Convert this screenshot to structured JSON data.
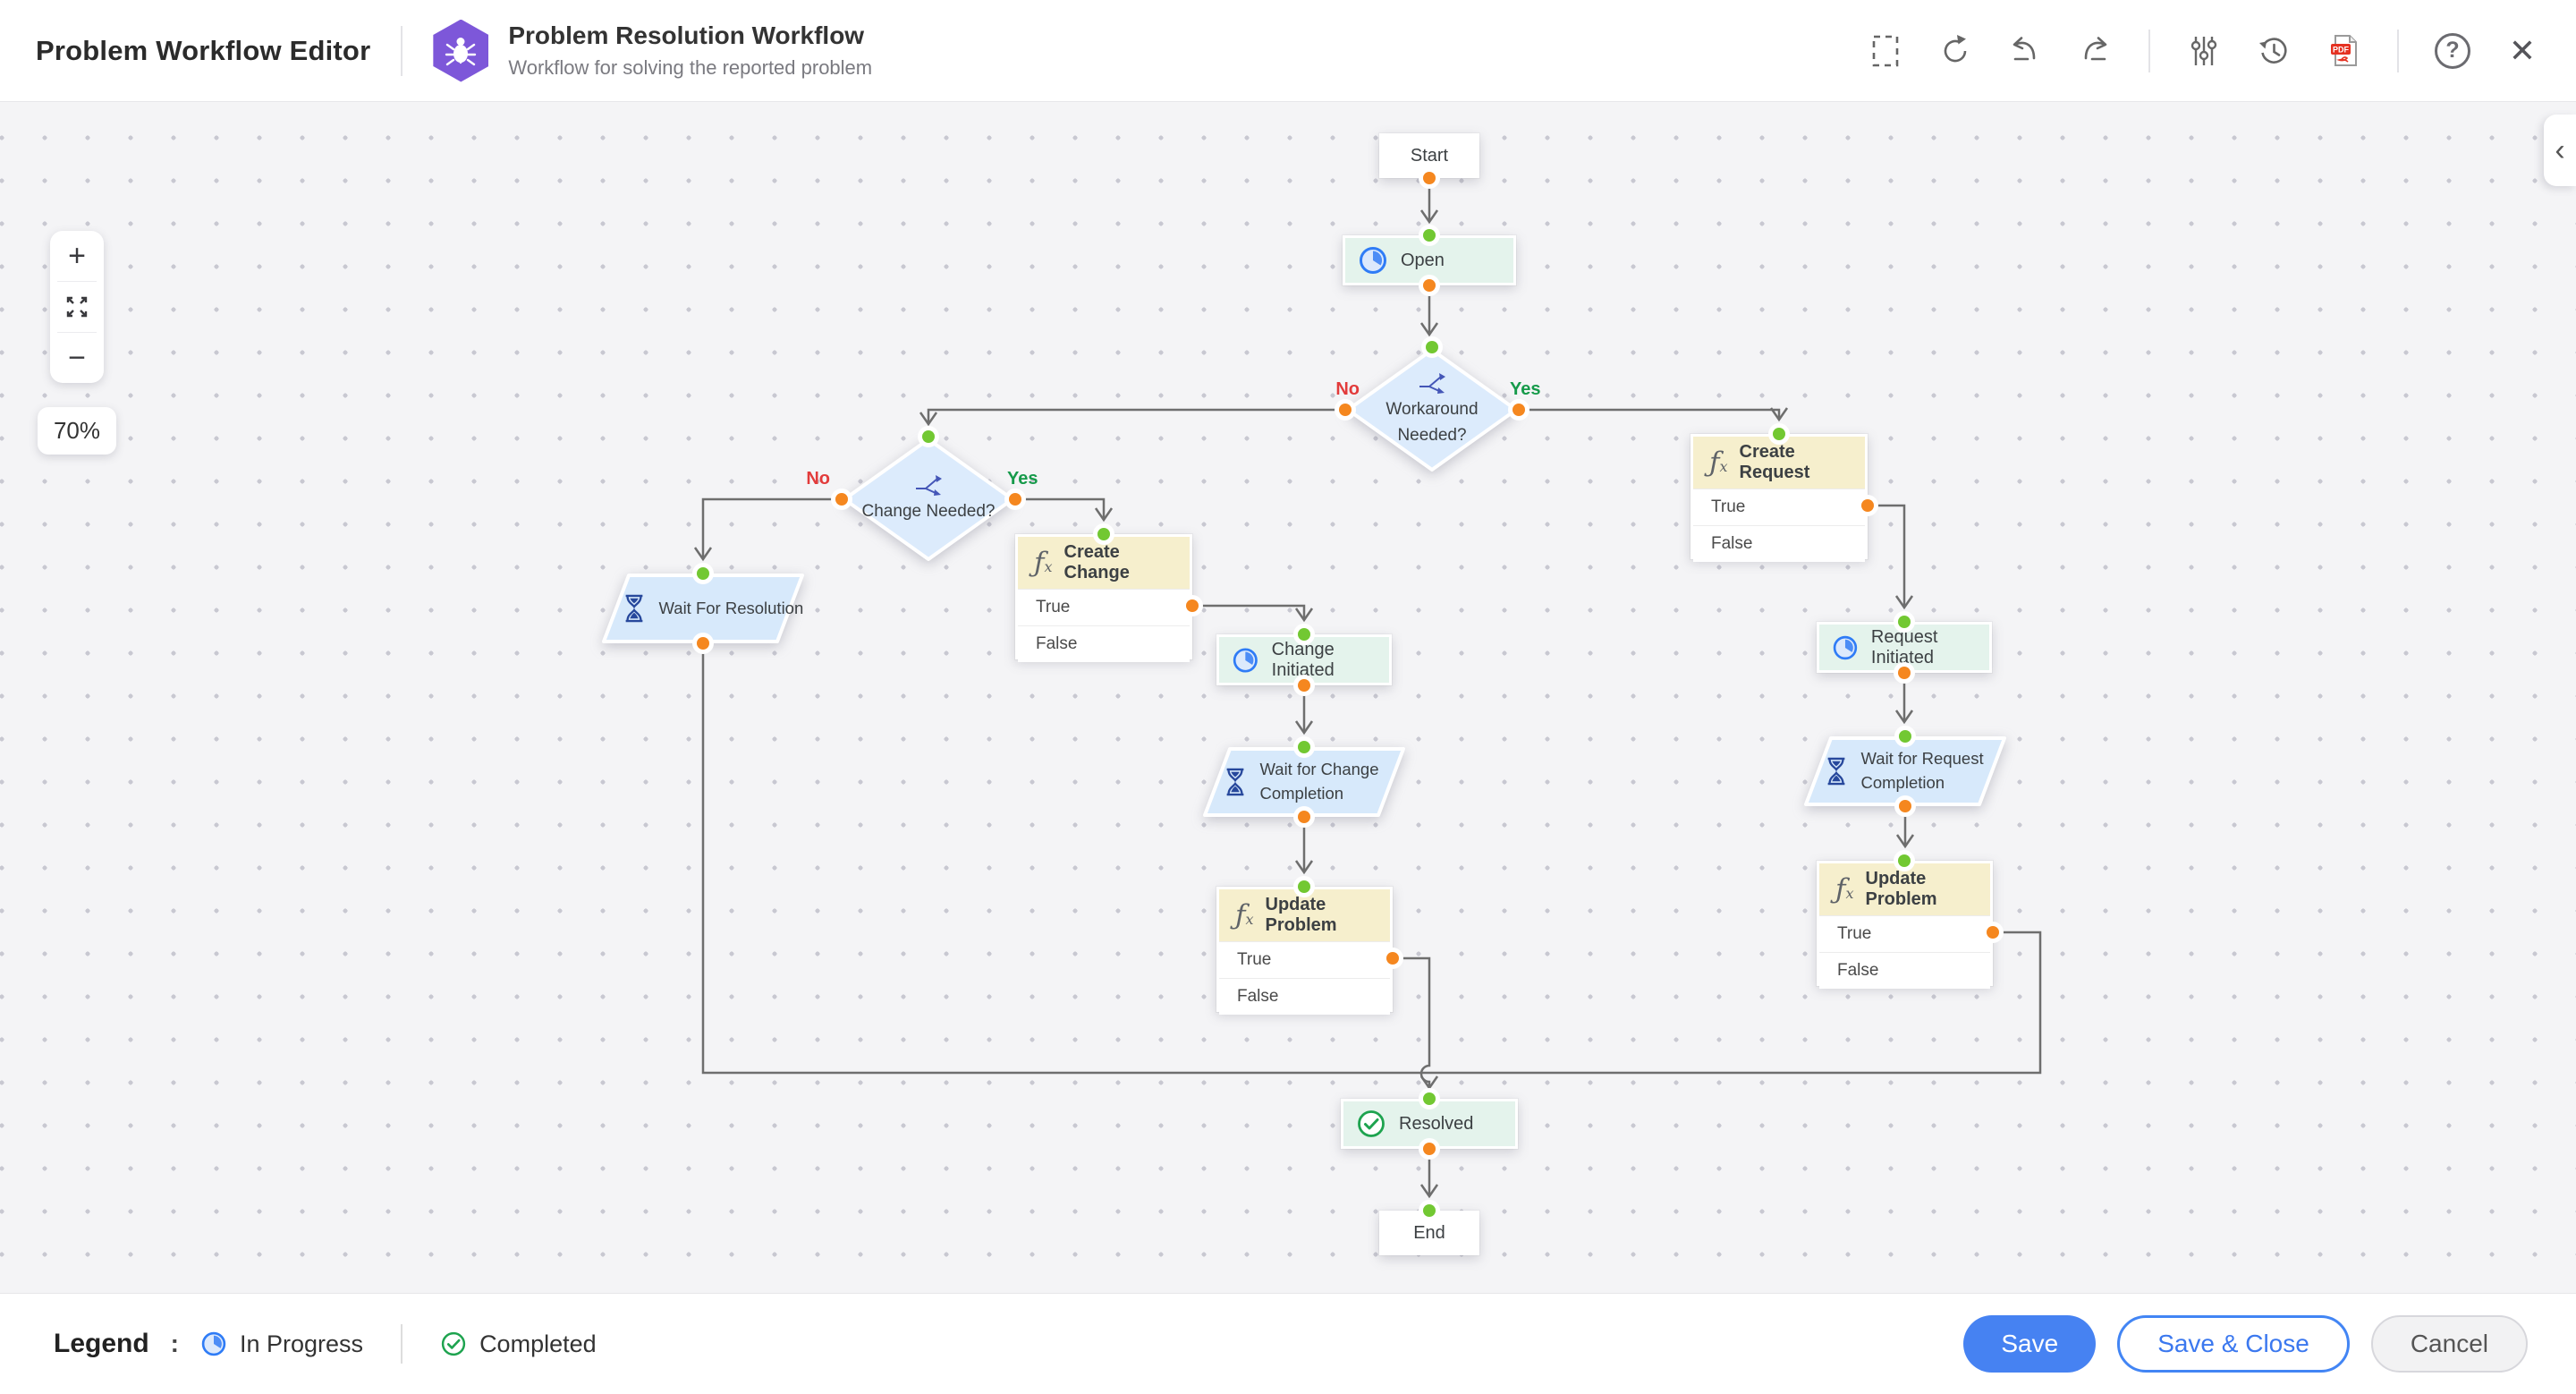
{
  "header": {
    "app_title": "Problem Workflow Editor",
    "workflow_title": "Problem Resolution Workflow",
    "workflow_subtitle": "Workflow for solving the reported problem"
  },
  "icons": {
    "pdf_label": "PDF",
    "help_glyph": "?",
    "close_glyph": "✕",
    "collapse_chevron": "‹",
    "zoom_in_glyph": "+",
    "zoom_out_glyph": "−",
    "function_glyph": "ƒx"
  },
  "zoom_controls": {
    "zoom_level": "70%"
  },
  "nodes": {
    "start": "Start",
    "open": "Open",
    "workaround_needed": "Workaround Needed?",
    "change_needed": "Change Needed?",
    "create_request": "Create Request",
    "create_change": "Create Change",
    "wait_for_resolution": "Wait For Resolution",
    "change_initiated": "Change Initiated",
    "wait_for_change_completion": "Wait for Change Completion",
    "update_problem_change": "Update Problem",
    "request_initiated": "Request Initiated",
    "wait_for_request_completion": "Wait for Request Completion",
    "update_problem_request": "Update Problem",
    "resolved": "Resolved",
    "end": "End"
  },
  "branch_labels": {
    "no": "No",
    "yes": "Yes"
  },
  "row_labels": {
    "true": "True",
    "false": "False"
  },
  "legend": {
    "title": "Legend",
    "colon": ":",
    "in_progress": "In Progress",
    "completed": "Completed"
  },
  "actions": {
    "save": "Save",
    "save_and_close": "Save & Close",
    "cancel": "Cancel"
  },
  "colors": {
    "accent_blue": "#4285f4",
    "port_orange": "#f5871f",
    "port_green": "#72c832",
    "in_progress_blue": "#2f7cf6",
    "completed_green": "#1ea34f",
    "branch_no_red": "#e23b3b",
    "branch_yes_green": "#169a4a",
    "node_status_bg": "#e4f3ec",
    "node_decision_bg": "#dcebfc",
    "node_wait_bg": "#d7e9fb",
    "fx_header_bg": "#f6efcd"
  }
}
